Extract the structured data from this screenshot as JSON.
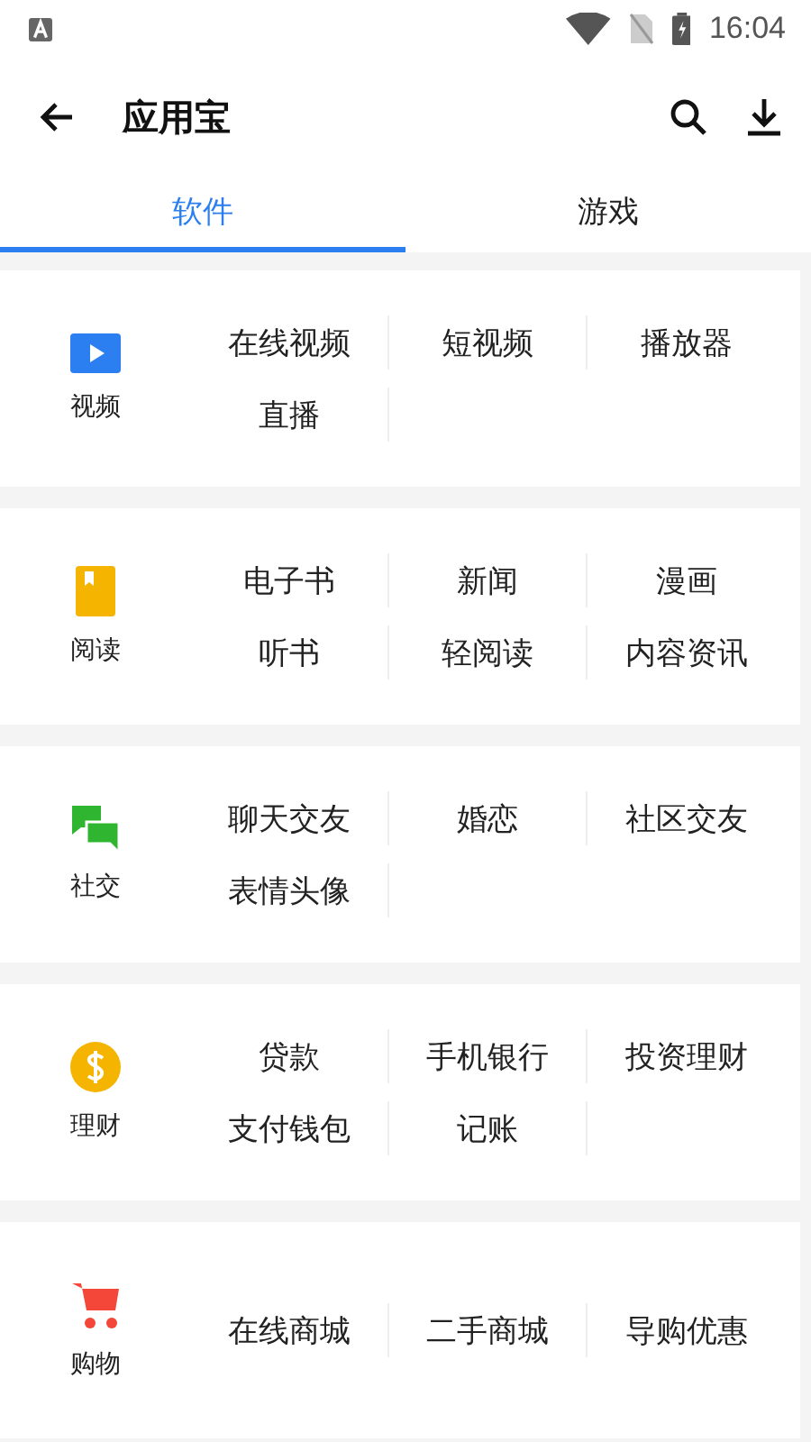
{
  "status_bar": {
    "time": "16:04"
  },
  "app_bar": {
    "title": "应用宝"
  },
  "tabs": [
    {
      "label": "软件",
      "selected": true
    },
    {
      "label": "游戏",
      "selected": false
    }
  ],
  "categories": [
    {
      "kind": "video",
      "name": "视频",
      "color": "#2b7ff0",
      "items": [
        "在线视频",
        "短视频",
        "播放器",
        "直播"
      ]
    },
    {
      "kind": "reading",
      "name": "阅读",
      "color": "#f4b400",
      "items": [
        "电子书",
        "新闻",
        "漫画",
        "听书",
        "轻阅读",
        "内容资讯"
      ]
    },
    {
      "kind": "social",
      "name": "社交",
      "color": "#2fb52f",
      "items": [
        "聊天交友",
        "婚恋",
        "社区交友",
        "表情头像"
      ]
    },
    {
      "kind": "finance",
      "name": "理财",
      "color": "#f4b400",
      "items": [
        "贷款",
        "手机银行",
        "投资理财",
        "支付钱包",
        "记账"
      ]
    },
    {
      "kind": "shopping",
      "name": "购物",
      "color": "#f4473a",
      "items": [
        "在线商城",
        "二手商城",
        "导购优惠"
      ]
    }
  ]
}
